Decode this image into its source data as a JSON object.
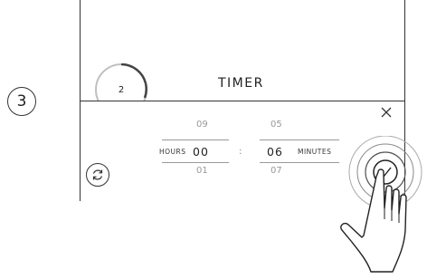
{
  "step": {
    "number": "3"
  },
  "device": {
    "dial": {
      "value": "2"
    },
    "title": "TIMER"
  },
  "picker": {
    "hours": {
      "label": "HOURS",
      "prev": "09",
      "current": "00",
      "next": "01"
    },
    "separator": ":",
    "minutes": {
      "label": "MINUTES",
      "prev": "05",
      "current": "06",
      "next": "07"
    }
  },
  "icons": {
    "close": "close-icon",
    "reset": "reset-icon",
    "confirm": "check-icon",
    "hand": "pointing-hand-icon"
  }
}
